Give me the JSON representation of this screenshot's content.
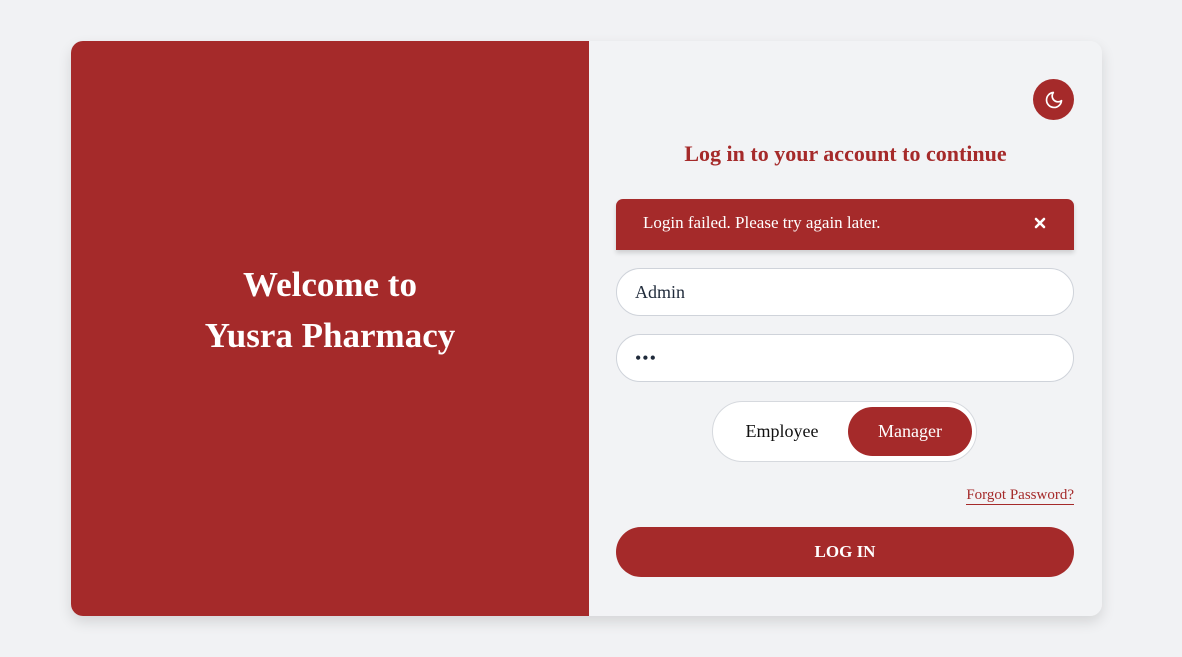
{
  "brand": {
    "welcome_line1": "Welcome to",
    "welcome_line2": "Yusra Pharmacy",
    "primary_color": "#a52a2a"
  },
  "theme_toggle": {
    "icon": "moon-icon"
  },
  "form": {
    "heading": "Log in to your account to continue",
    "alert": {
      "message": "Login failed. Please try again later.",
      "close_icon": "close-icon"
    },
    "username": {
      "value": "Admin"
    },
    "password": {
      "value": "•••"
    },
    "roles": {
      "options": [
        "Employee",
        "Manager"
      ],
      "selected": "Manager"
    },
    "forgot_password": "Forgot Password?",
    "submit_label": "LOG IN"
  }
}
